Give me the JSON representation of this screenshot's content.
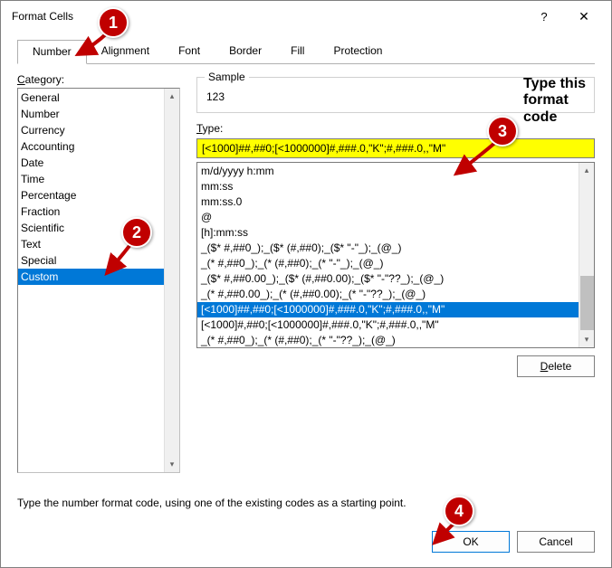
{
  "dialog": {
    "title": "Format Cells",
    "help_icon": "?",
    "close_icon": "✕"
  },
  "tabs": [
    "Number",
    "Alignment",
    "Font",
    "Border",
    "Fill",
    "Protection"
  ],
  "active_tab": 0,
  "labels": {
    "category": "Category:",
    "sample": "Sample",
    "type": "Type:"
  },
  "categories": [
    "General",
    "Number",
    "Currency",
    "Accounting",
    "Date",
    "Time",
    "Percentage",
    "Fraction",
    "Scientific",
    "Text",
    "Special",
    "Custom"
  ],
  "category_selected_index": 11,
  "sample_value": "123",
  "type_value": "[<1000]##,##0;[<1000000]#,###.0,\"K\";#,###.0,,\"M\"",
  "type_list": [
    "m/d/yyyy h:mm",
    "mm:ss",
    "mm:ss.0",
    "@",
    "[h]:mm:ss",
    "_($* #,##0_);_($* (#,##0);_($* \"-\"_);_(@_)",
    "_(* #,##0_);_(* (#,##0);_(* \"-\"_);_(@_)",
    "_($* #,##0.00_);_($* (#,##0.00);_($* \"-\"??_);_(@_)",
    "_(* #,##0.00_);_(* (#,##0.00);_(* \"-\"??_);_(@_)",
    "[<1000]##,##0;[<1000000]#,###.0,\"K\";#,###.0,,\"M\"",
    "[<1000]#,##0;[<1000000]#,###.0,\"K\";#,###.0,,\"M\"",
    "_(* #,##0_);_(* (#,##0);_(* \"-\"??_);_(@_)"
  ],
  "type_list_selected_index": 9,
  "buttons": {
    "delete": "Delete",
    "ok": "OK",
    "cancel": "Cancel"
  },
  "instruction_text": "Type the number format code, using one of the existing codes as a starting point.",
  "annotations": {
    "a1": "1",
    "a2": "2",
    "a3": "3",
    "a4": "4",
    "text": "Type this\nformat\ncode"
  }
}
